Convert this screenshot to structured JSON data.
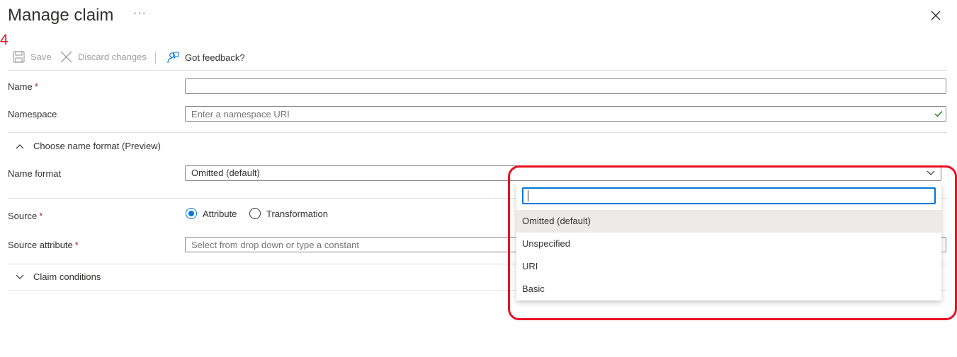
{
  "header": {
    "title": "Manage claim",
    "more": "···",
    "step_number": "4"
  },
  "toolbar": {
    "save_label": "Save",
    "discard_label": "Discard changes",
    "feedback_label": "Got feedback?"
  },
  "form": {
    "name": {
      "label": "Name",
      "required_mark": "*",
      "value": ""
    },
    "namespace": {
      "label": "Namespace",
      "placeholder": "Enter a namespace URI"
    },
    "name_format_section": {
      "label": "Choose name format (Preview)"
    },
    "name_format": {
      "label": "Name format",
      "selected": "Omitted (default)"
    },
    "source": {
      "label": "Source",
      "required_mark": "*",
      "options": [
        "Attribute",
        "Transformation"
      ],
      "selected": "Attribute"
    },
    "source_attribute": {
      "label": "Source attribute",
      "required_mark": "*",
      "placeholder": "Select from drop down or type a constant"
    },
    "claim_conditions_section": {
      "label": "Claim conditions"
    }
  },
  "dropdown": {
    "search_value": "",
    "options": [
      "Omitted (default)",
      "Unspecified",
      "URI",
      "Basic"
    ],
    "selected_option": "Omitted (default)"
  },
  "colors": {
    "accent": "#0078d4",
    "highlight": "#e81123",
    "success": "#107c10"
  }
}
